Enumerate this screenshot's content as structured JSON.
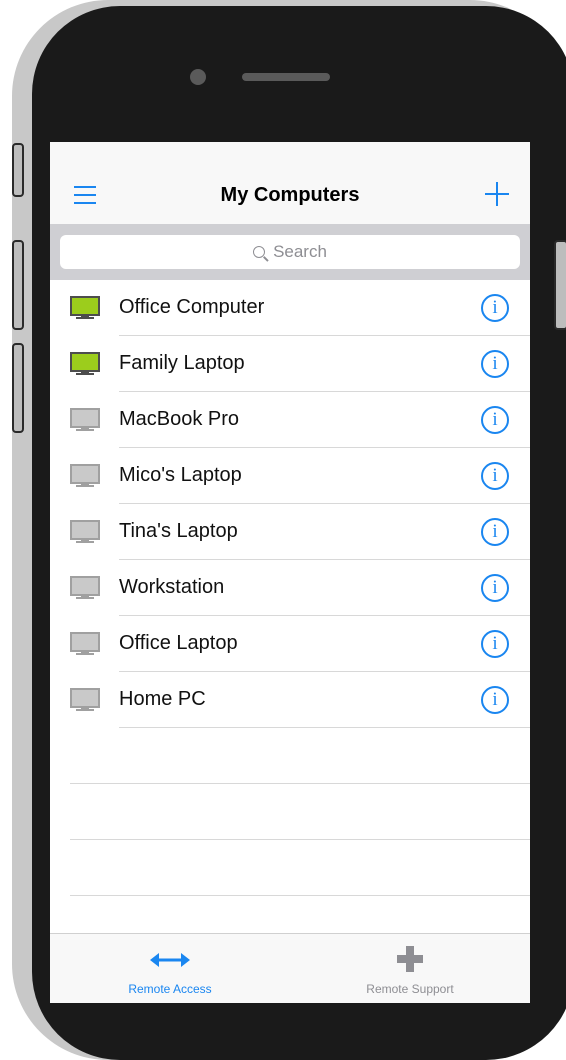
{
  "nav": {
    "title": "My Computers",
    "menu_icon": "menu-icon",
    "add_icon": "plus-icon"
  },
  "search": {
    "placeholder": "Search"
  },
  "computers": [
    {
      "name": "Office Computer",
      "status": "online"
    },
    {
      "name": "Family Laptop",
      "status": "online"
    },
    {
      "name": "MacBook Pro",
      "status": "offline"
    },
    {
      "name": "Mico's Laptop",
      "status": "offline"
    },
    {
      "name": "Tina's Laptop",
      "status": "offline"
    },
    {
      "name": "Workstation",
      "status": "offline"
    },
    {
      "name": "Office Laptop",
      "status": "offline"
    },
    {
      "name": "Home PC",
      "status": "offline"
    }
  ],
  "tabs": [
    {
      "label": "Remote Access",
      "icon": "double-arrow-icon",
      "active": true
    },
    {
      "label": "Remote Support",
      "icon": "plus-cross-icon",
      "active": false
    }
  ],
  "colors": {
    "accent": "#1a86f0",
    "online": "#9ccd1c",
    "offline": "#c9c9c9"
  }
}
